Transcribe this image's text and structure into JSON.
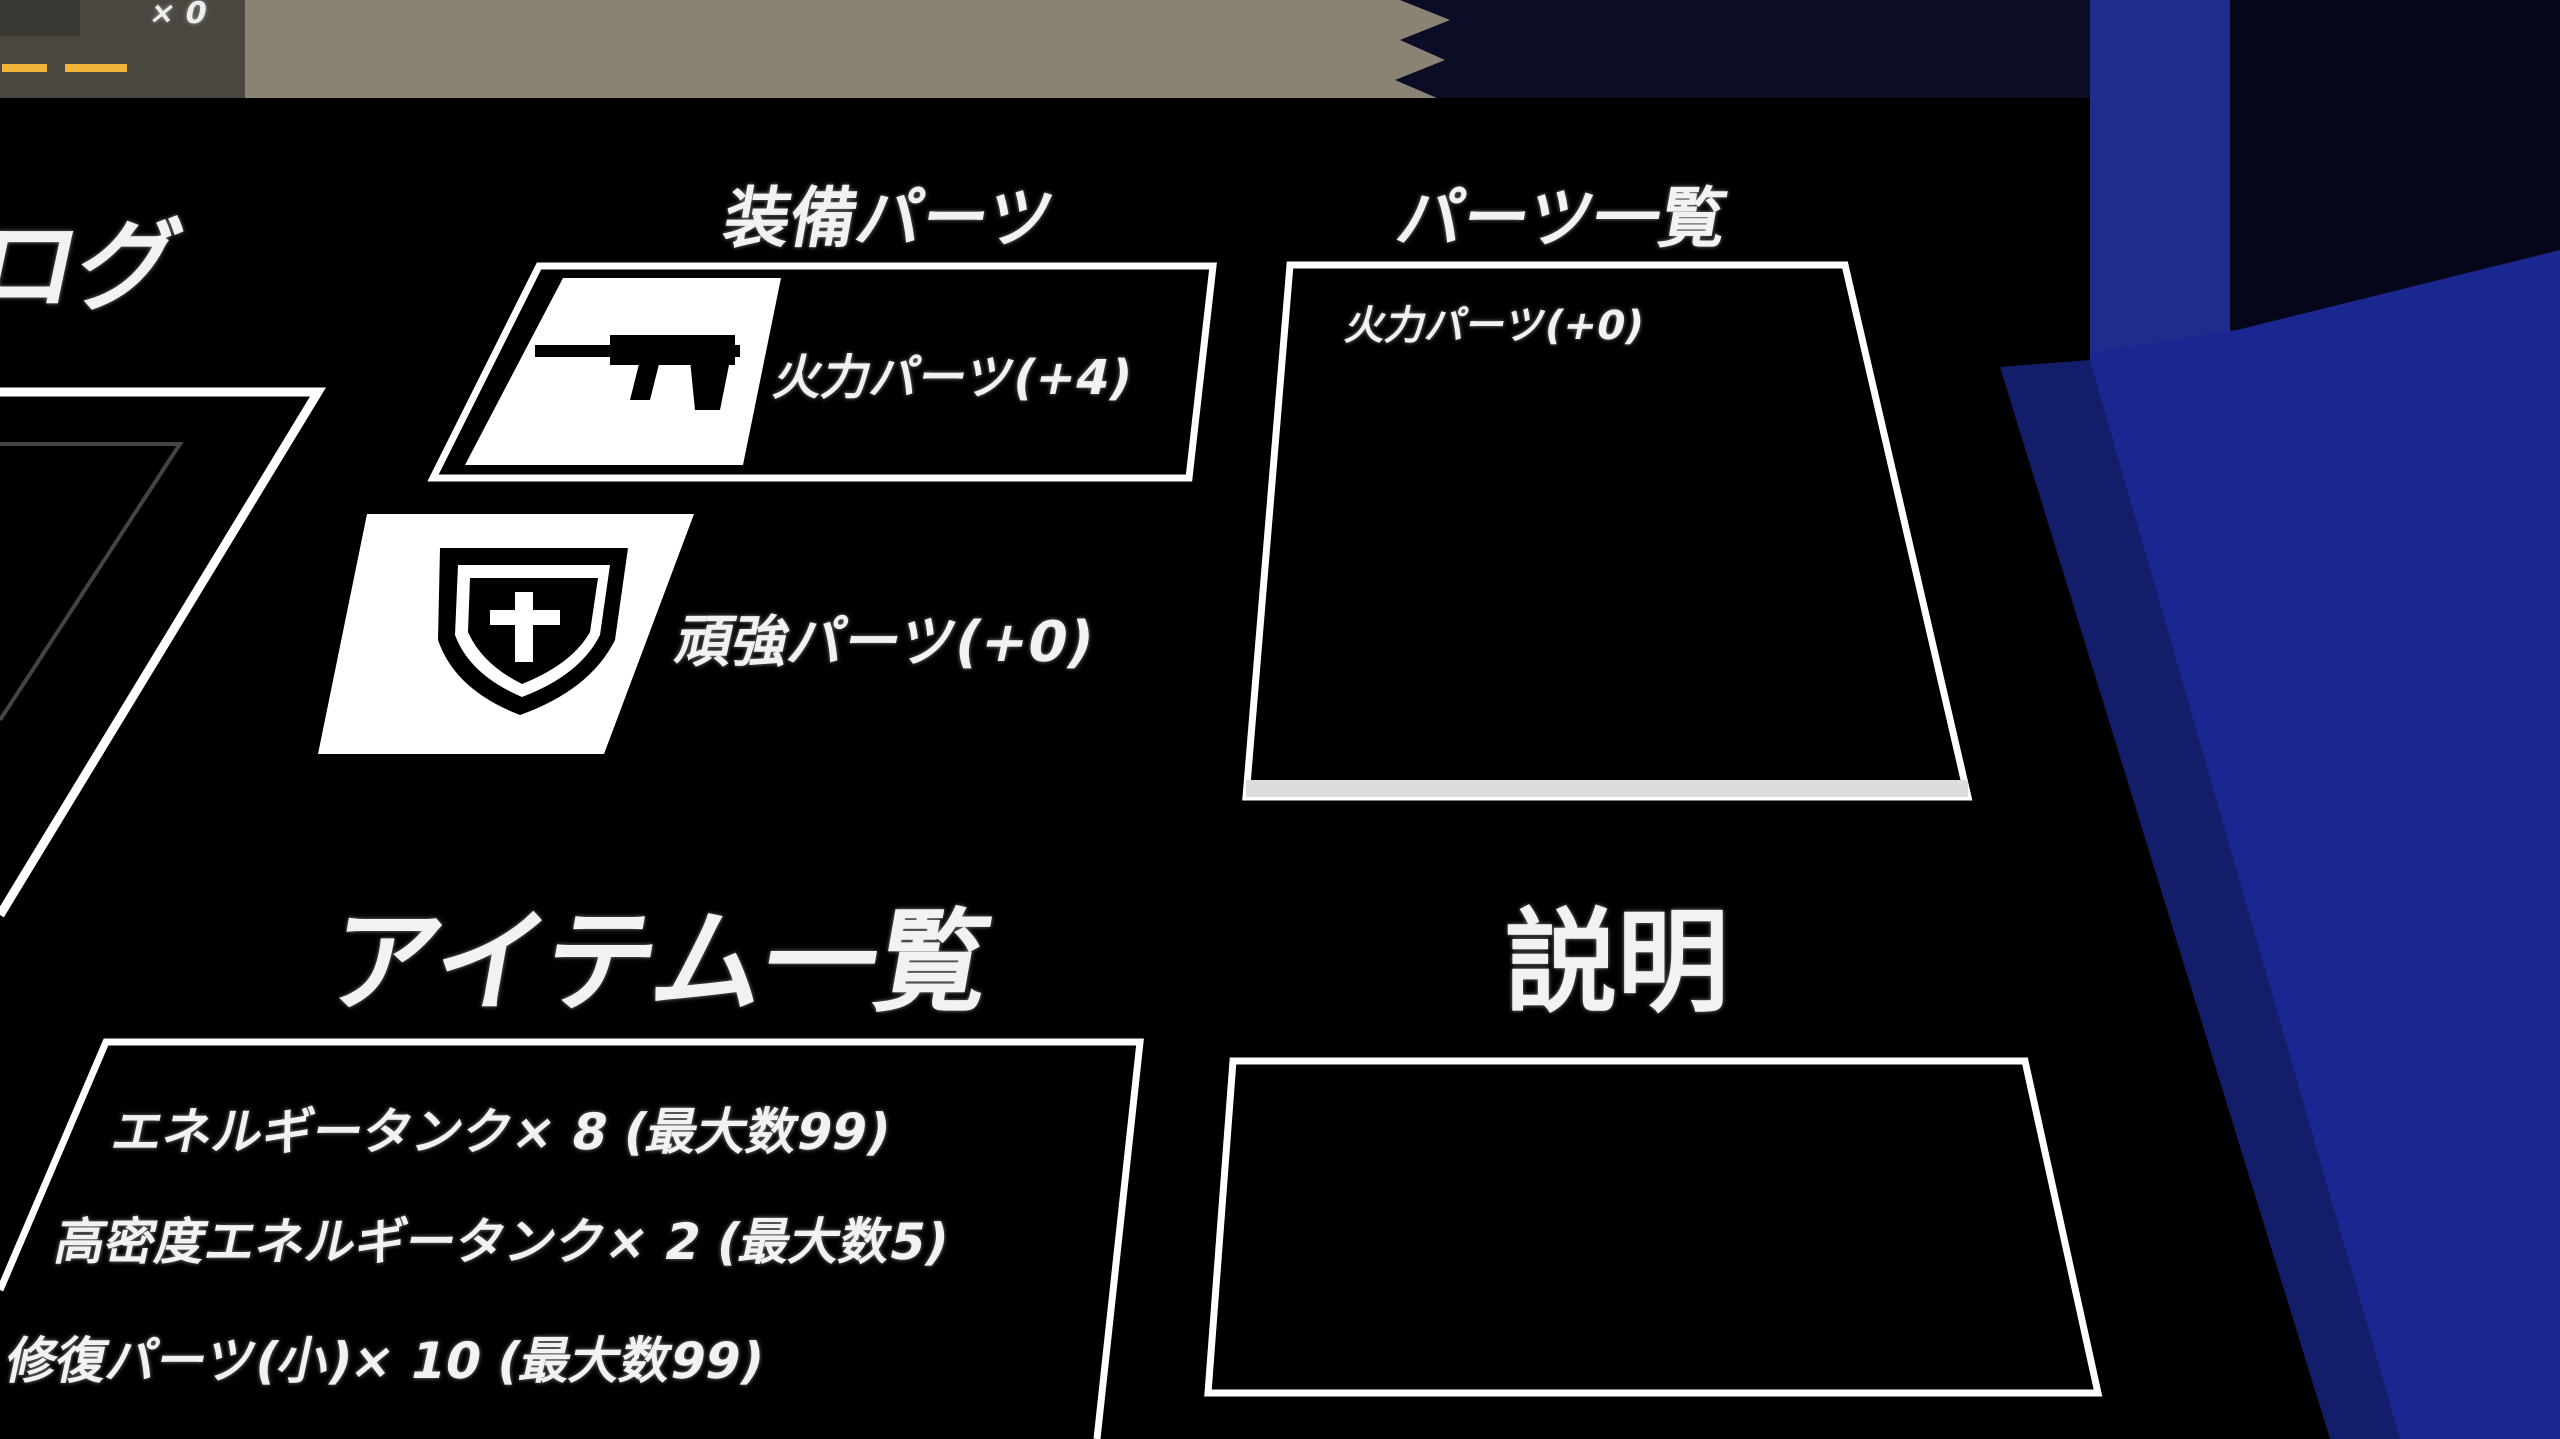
{
  "hud": {
    "top_counter": "× 0"
  },
  "log": {
    "title": "ログ"
  },
  "equipped": {
    "title": "装備パーツ",
    "slots": [
      {
        "icon": "gun-icon",
        "label": "火力パーツ(+4)"
      },
      {
        "icon": "shield-cross-icon",
        "label": "頑強パーツ(+0)"
      }
    ]
  },
  "parts_list": {
    "title": "パーツ一覧",
    "items": [
      "火力パーツ(+0)"
    ]
  },
  "items_list": {
    "title": "アイテム一覧",
    "items": [
      "エネルギータンク× 8 (最大数99)",
      "高密度エネルギータンク× 2 (最大数5)",
      "修復パーツ(小)× 10 (最大数99)"
    ]
  },
  "description": {
    "title": "説明",
    "text": ""
  },
  "colors": {
    "panel": "#000000",
    "frame": "#ffffff",
    "wall_blue": "#1b2790",
    "top_band": "#8a8374",
    "hud_bar": "#f2b53a"
  }
}
